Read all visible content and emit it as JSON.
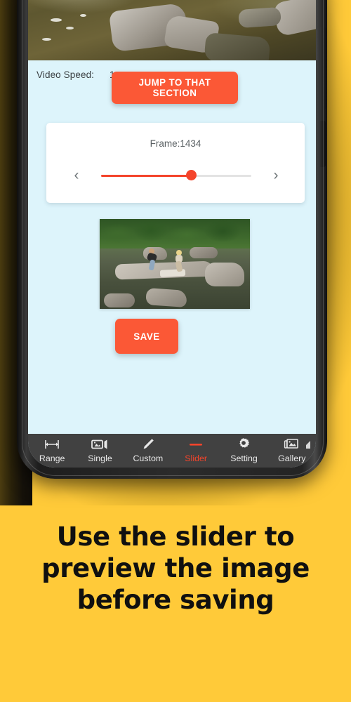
{
  "promo": {
    "background_color": "#FFCA39",
    "caption_lines": [
      "Use the slider to",
      "preview the image",
      "before saving"
    ]
  },
  "app": {
    "background_color": "#ddf4fb",
    "accent_color": "#FB5836",
    "slider_color": "#F4442B",
    "video_preview": {
      "alt": "river-video-frame"
    },
    "video_speed": {
      "label": "Video Speed:",
      "value": "1",
      "caret_icon": "chevron-down-icon"
    },
    "jump_button": {
      "label": "JUMP TO THAT SECTION"
    },
    "frame_card": {
      "frame_label": "Frame:1434",
      "prev_icon": "chevron-left-icon",
      "next_icon": "chevron-right-icon",
      "slider": {
        "percent": 60,
        "min_label": "",
        "max_label": ""
      }
    },
    "preview_thumbnail": {
      "alt": "river-scene-preview"
    },
    "save_button": {
      "label": "SAVE"
    },
    "bottom_nav": {
      "items": [
        {
          "label": "Range",
          "icon": "arrows-horizontal-icon",
          "active": false
        },
        {
          "label": "Single",
          "icon": "video-frame-icon",
          "active": false
        },
        {
          "label": "Custom",
          "icon": "pencil-icon",
          "active": false
        },
        {
          "label": "Slider",
          "icon": "slider-dash-icon",
          "active": true
        },
        {
          "label": "Setting",
          "icon": "gear-icon",
          "active": false
        },
        {
          "label": "Gallery",
          "icon": "photos-stack-icon",
          "active": false
        }
      ]
    }
  }
}
